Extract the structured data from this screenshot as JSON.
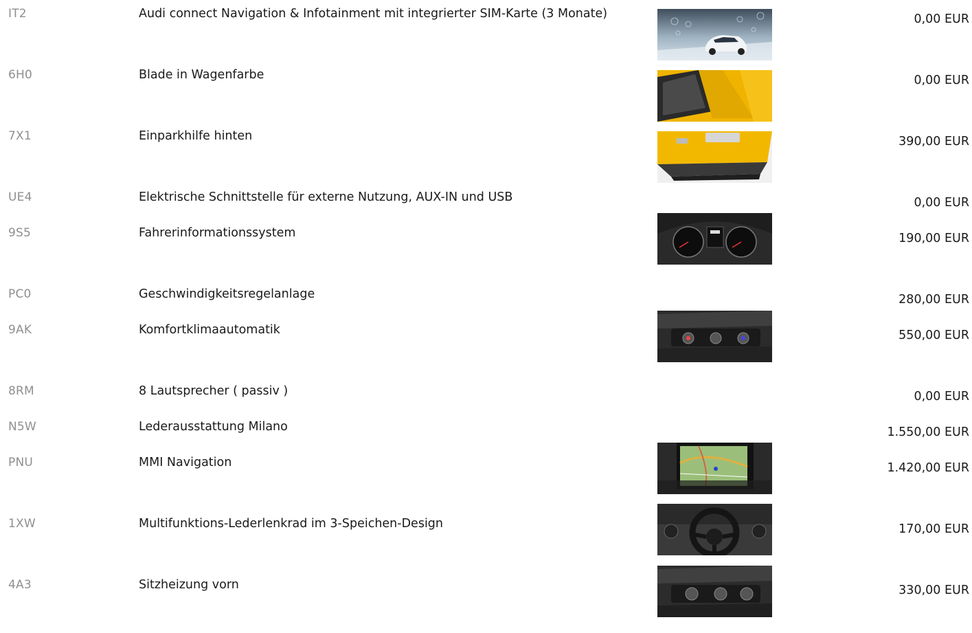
{
  "equipment": [
    {
      "code": "IT2",
      "description": "Audi connect Navigation & Infotainment mit integrierter SIM-Karte (3 Monate)",
      "price": "0,00 EUR",
      "image": "connect-car-image"
    },
    {
      "code": "6H0",
      "description": "Blade in Wagenfarbe",
      "price": "0,00 EUR",
      "image": "yellow-blade-image"
    },
    {
      "code": "7X1",
      "description": "Einparkhilfe hinten",
      "price": "390,00 EUR",
      "image": "rear-park-image"
    },
    {
      "code": "UE4",
      "description": "Elektrische Schnittstelle für externe Nutzung, AUX-IN und USB",
      "price": "0,00 EUR",
      "image": null
    },
    {
      "code": "9S5",
      "description": "Fahrerinformationssystem",
      "price": "190,00 EUR",
      "image": "instrument-cluster-image"
    },
    {
      "code": "PC0",
      "description": "Geschwindigkeitsregelanlage",
      "price": "280,00 EUR",
      "image": null
    },
    {
      "code": "9AK",
      "description": "Komfortklimaautomatik",
      "price": "550,00 EUR",
      "image": "climate-control-image"
    },
    {
      "code": "8RM",
      "description": "8 Lautsprecher ( passiv )",
      "price": "0,00 EUR",
      "image": null
    },
    {
      "code": "N5W",
      "description": "Lederausstattung Milano",
      "price": "1.550,00 EUR",
      "image": null
    },
    {
      "code": "PNU",
      "description": "MMI Navigation",
      "price": "1.420,00 EUR",
      "image": "mmi-navigation-image"
    },
    {
      "code": "1XW",
      "description": "Multifunktions-Lederlenkrad im 3-Speichen-Design",
      "price": "170,00 EUR",
      "image": "steering-wheel-image"
    },
    {
      "code": "4A3",
      "description": "Sitzheizung vorn",
      "price": "330,00 EUR",
      "image": "seat-heating-image"
    }
  ]
}
